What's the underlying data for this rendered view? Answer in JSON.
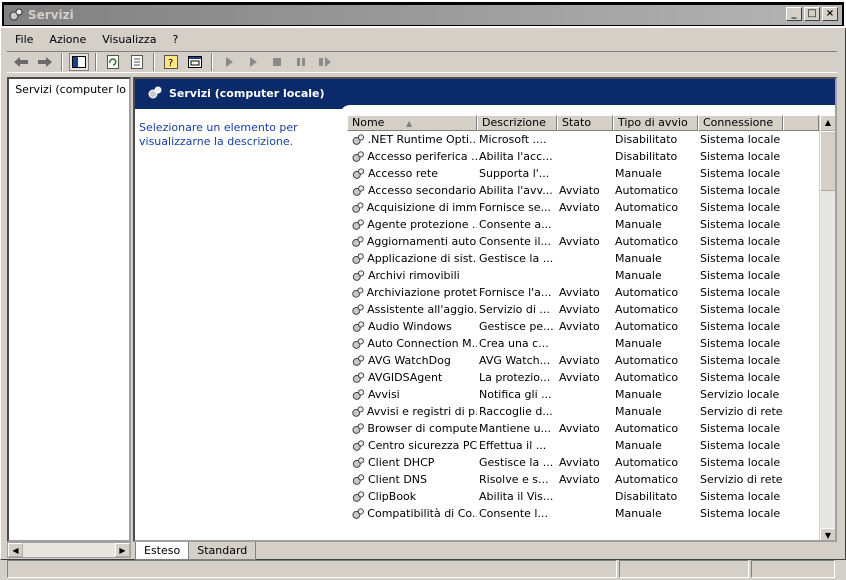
{
  "window": {
    "title": "Servizi",
    "buttons": [
      "_",
      "□",
      "×"
    ]
  },
  "menubar": [
    "File",
    "Azione",
    "Visualizza",
    "?"
  ],
  "toolbar": [
    "back-arrow-icon",
    "forward-arrow-icon",
    "show-tree-icon",
    "refresh-icon",
    "export-icon",
    "help-icon",
    "properties-icon",
    "play-icon",
    "play-alt-icon",
    "stop-icon",
    "pause-icon",
    "restart-icon"
  ],
  "tree": {
    "root": "Servizi (computer lo"
  },
  "panel": {
    "title": "Servizi (computer locale)",
    "description": "Selezionare un elemento per visualizzarne la descrizione."
  },
  "table": {
    "headers": [
      "Nome",
      "Descrizione",
      "Stato",
      "Tipo di avvio",
      "Connessione"
    ],
    "sort_indicator": "▲",
    "rows": [
      [
        ".NET Runtime Opti...",
        "Microsoft ....",
        "",
        "Disabilitato",
        "Sistema locale"
      ],
      [
        "Accesso periferica ...",
        "Abilita l'acc...",
        "",
        "Disabilitato",
        "Sistema locale"
      ],
      [
        "Accesso rete",
        "Supporta l'...",
        "",
        "Manuale",
        "Sistema locale"
      ],
      [
        "Accesso secondario",
        "Abilita l'avv...",
        "Avviato",
        "Automatico",
        "Sistema locale"
      ],
      [
        "Acquisizione di imm...",
        "Fornisce se...",
        "Avviato",
        "Automatico",
        "Sistema locale"
      ],
      [
        "Agente protezione ...",
        "Consente a...",
        "",
        "Manuale",
        "Sistema locale"
      ],
      [
        "Aggiornamenti auto...",
        "Consente il...",
        "Avviato",
        "Automatico",
        "Sistema locale"
      ],
      [
        "Applicazione di sist...",
        "Gestisce la ...",
        "",
        "Manuale",
        "Sistema locale"
      ],
      [
        "Archivi rimovibili",
        "",
        "",
        "Manuale",
        "Sistema locale"
      ],
      [
        "Archiviazione protetta",
        "Fornisce l'a...",
        "Avviato",
        "Automatico",
        "Sistema locale"
      ],
      [
        "Assistente all'aggio...",
        "Servizio di ...",
        "Avviato",
        "Automatico",
        "Sistema locale"
      ],
      [
        "Audio Windows",
        "Gestisce pe...",
        "Avviato",
        "Automatico",
        "Sistema locale"
      ],
      [
        "Auto Connection M...",
        "Crea una c...",
        "",
        "Manuale",
        "Sistema locale"
      ],
      [
        "AVG WatchDog",
        "AVG Watch...",
        "Avviato",
        "Automatico",
        "Sistema locale"
      ],
      [
        "AVGIDSAgent",
        "La protezio...",
        "Avviato",
        "Automatico",
        "Sistema locale"
      ],
      [
        "Avvisi",
        "Notifica gli ...",
        "",
        "Manuale",
        "Servizio locale"
      ],
      [
        "Avvisi e registri di p...",
        "Raccoglie d...",
        "",
        "Manuale",
        "Servizio di rete"
      ],
      [
        "Browser di computer",
        "Mantiene u...",
        "Avviato",
        "Automatico",
        "Sistema locale"
      ],
      [
        "Centro sicurezza PC",
        "Effettua il ...",
        "",
        "Manuale",
        "Sistema locale"
      ],
      [
        "Client DHCP",
        "Gestisce la ...",
        "Avviato",
        "Automatico",
        "Sistema locale"
      ],
      [
        "Client DNS",
        "Risolve e s...",
        "Avviato",
        "Automatico",
        "Servizio di rete"
      ],
      [
        "ClipBook",
        "Abilita il Vis...",
        "",
        "Disabilitato",
        "Sistema locale"
      ],
      [
        "Compatibilità di Co...",
        "Consente l...",
        "",
        "Manuale",
        "Sistema locale"
      ]
    ]
  },
  "tabs": [
    "Esteso",
    "Standard"
  ]
}
